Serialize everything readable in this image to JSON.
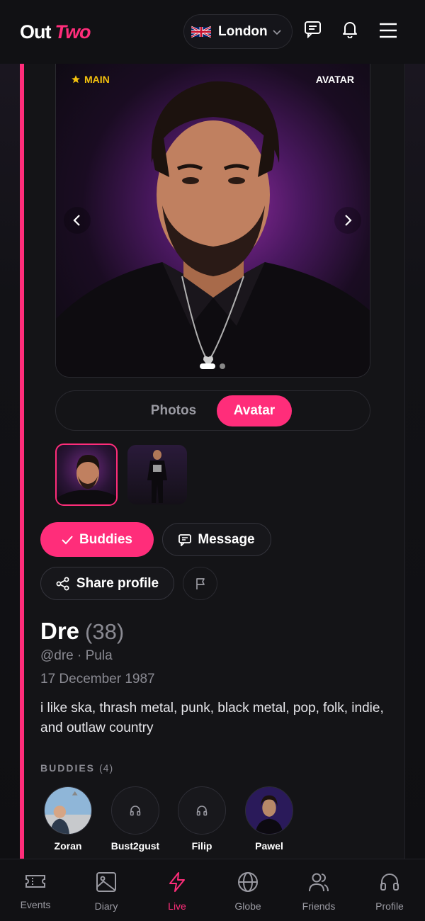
{
  "header": {
    "logo_part1": "Out",
    "logo_part2": "Two",
    "location": "London"
  },
  "photo": {
    "badge_main": "MAIN",
    "badge_avatar": "AVATAR",
    "slide_count": 2,
    "active_slide": 1
  },
  "toggle": {
    "photos_label": "Photos",
    "avatar_label": "Avatar",
    "active": "Avatar"
  },
  "actions": {
    "buddies_label": "Buddies",
    "message_label": "Message",
    "share_label": "Share profile"
  },
  "profile": {
    "name": "Dre",
    "age": "(38)",
    "handle_location": "@dre · Pula",
    "birthday": "17 December 1987",
    "bio": "i like ska, thrash metal, punk, black metal, pop, folk, indie, and outlaw country"
  },
  "buddies": {
    "heading": "BUDDIES",
    "count": "(4)",
    "items": [
      {
        "name": "Zoran"
      },
      {
        "name": "Bust2gust"
      },
      {
        "name": "Filip"
      },
      {
        "name": "Pawel"
      }
    ]
  },
  "nav": {
    "items": [
      {
        "label": "Events"
      },
      {
        "label": "Diary"
      },
      {
        "label": "Live"
      },
      {
        "label": "Globe"
      },
      {
        "label": "Friends"
      },
      {
        "label": "Profile"
      }
    ],
    "active": "Live"
  },
  "colors": {
    "accent": "#ff2d7a",
    "star": "#f4c20d",
    "bg": "#141417"
  }
}
